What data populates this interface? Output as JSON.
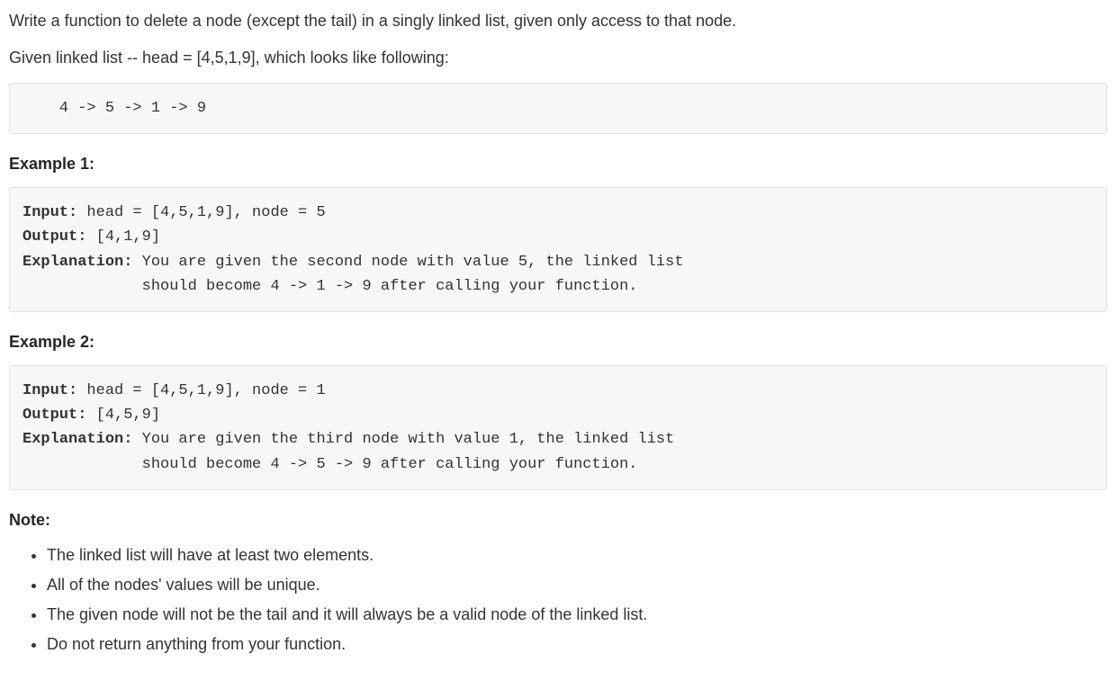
{
  "intro": {
    "p1": "Write a function to delete a node (except the tail) in a singly linked list, given only access to that node.",
    "p2": "Given linked list -- head = [4,5,1,9], which looks like following:"
  },
  "diagram": "    4 -> 5 -> 1 -> 9",
  "example1": {
    "heading": "Example 1:",
    "input_label": "Input:",
    "input_value": " head = [4,5,1,9], node = 5",
    "output_label": "Output:",
    "output_value": " [4,1,9]",
    "explanation_label": "Explanation:",
    "explanation_value": " You are given the second node with value 5, the linked list\n             should become 4 -> 1 -> 9 after calling your function."
  },
  "example2": {
    "heading": "Example 2:",
    "input_label": "Input:",
    "input_value": " head = [4,5,1,9], node = 1",
    "output_label": "Output:",
    "output_value": " [4,5,9]",
    "explanation_label": "Explanation:",
    "explanation_value": " You are given the third node with value 1, the linked list\n             should become 4 -> 5 -> 9 after calling your function."
  },
  "note": {
    "heading": "Note:",
    "items": [
      "The linked list will have at least two elements.",
      "All of the nodes' values will be unique.",
      "The given node will not be the tail and it will always be a valid node of the linked list.",
      "Do not return anything from your function."
    ]
  }
}
